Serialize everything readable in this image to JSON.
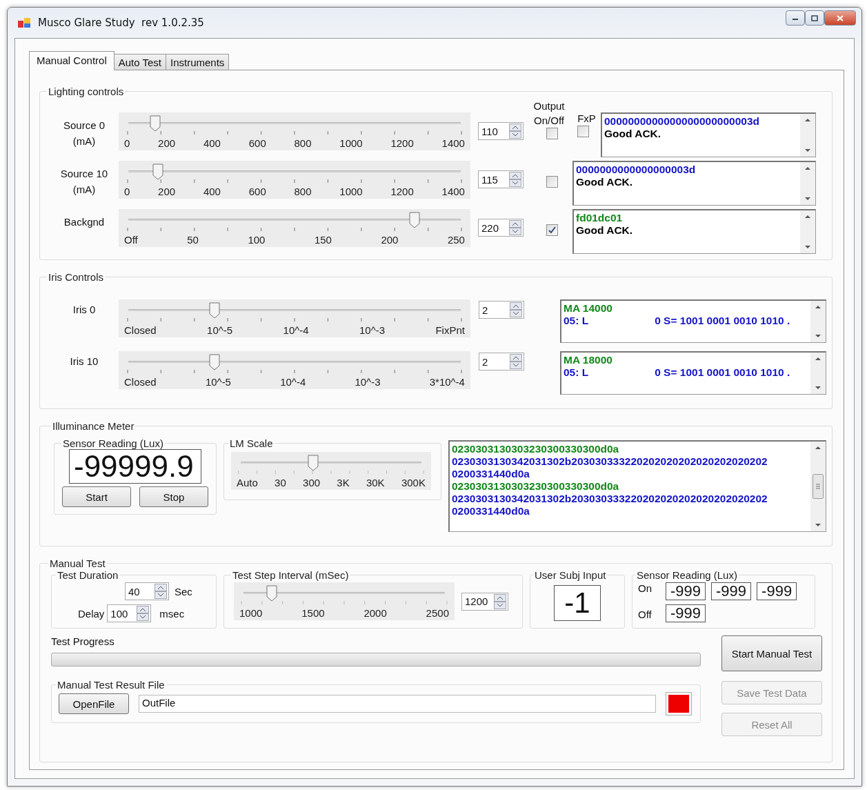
{
  "window": {
    "title": "Musco Glare Study  rev 1.0.2.35"
  },
  "tabs": [
    {
      "label": "Manual Control",
      "selected": true
    },
    {
      "label": "Auto Test",
      "selected": false
    },
    {
      "label": "Instruments",
      "selected": false
    }
  ],
  "lighting_controls": {
    "title": "Lighting controls",
    "output_header": "Output On/Off",
    "rows": [
      {
        "label": "Source 0",
        "unit": "(mA)",
        "level": 0.08,
        "scale": [
          "0",
          "200",
          "400",
          "600",
          "800",
          "1000",
          "1200",
          "1400"
        ],
        "value": "110",
        "output_on": false,
        "fxp": {
          "label": "FxP",
          "checked": false
        },
        "log": [
          {
            "color": "#1414c8",
            "segments": [
              "0000000000000000000000003d"
            ]
          },
          {
            "color": "#000000",
            "segments": [
              "Good ACK."
            ]
          }
        ]
      },
      {
        "label": "Source 10",
        "unit": "(mA)",
        "level": 0.09,
        "scale": [
          "0",
          "200",
          "400",
          "600",
          "800",
          "1000",
          "1200",
          "1400"
        ],
        "value": "115",
        "output_on": false,
        "log": [
          {
            "color": "#1414c8",
            "segments": [
              "0000000000000000003d"
            ]
          },
          {
            "color": "#000000",
            "segments": [
              "Good ACK."
            ]
          }
        ]
      },
      {
        "label": "Backgnd",
        "level": 0.86,
        "scale": [
          "Off",
          "50",
          "100",
          "150",
          "200",
          "250"
        ],
        "value": "220",
        "output_on": true,
        "log": [
          {
            "color": "#12881a",
            "segments": [
              "fd01dc01"
            ]
          },
          {
            "color": "#000000",
            "segments": [
              "Good ACK."
            ]
          }
        ]
      }
    ]
  },
  "iris_controls": {
    "title": "Iris Controls",
    "rows": [
      {
        "label": "Iris 0",
        "level": 0.26,
        "scale": [
          "Closed",
          "10^-5",
          "10^-4",
          "10^-3",
          "FixPnt"
        ],
        "value": "2",
        "log": [
          {
            "color": "#12881a",
            "segments": [
              "MA 14000"
            ]
          },
          {
            "color": "#1414c8",
            "segments": [
              "05: L",
              "0 S= 1001 0001 0010 1010 ."
            ]
          }
        ]
      },
      {
        "label": "Iris 10",
        "level": 0.26,
        "scale": [
          "Closed",
          "10^-5",
          "10^-4",
          "10^-3",
          "3*10^-4"
        ],
        "value": "2",
        "log": [
          {
            "color": "#12881a",
            "segments": [
              "MA 18000"
            ]
          },
          {
            "color": "#1414c8",
            "segments": [
              "05: L",
              "0 S= 1001 0001 0010 1010 ."
            ]
          }
        ]
      }
    ]
  },
  "illuminance_meter": {
    "title": "Illuminance Meter",
    "sensor": {
      "title": "Sensor Reading (Lux)",
      "reading": "-99999.9",
      "buttons": [
        "Start",
        "Stop"
      ]
    },
    "lm_scale": {
      "title": "LM Scale",
      "level": 0.4,
      "scale": [
        "Auto",
        "30",
        "300",
        "3K",
        "30K",
        "300K"
      ]
    },
    "log": [
      {
        "color": "#12881a",
        "segments": [
          "0230303130303230300330300d0a"
        ]
      },
      {
        "color": "#1414c8",
        "segments": [
          "0230303130342031302b203030333220202020202020202020202"
        ]
      },
      {
        "color": "#1414c8",
        "segments": [
          "0200331440d0a"
        ]
      },
      {
        "color": "#12881a",
        "segments": [
          "0230303130303230300330300d0a"
        ]
      },
      {
        "color": "#1414c8",
        "segments": [
          "0230303130342031302b203030333220202020202020202020202"
        ]
      },
      {
        "color": "#1414c8",
        "segments": [
          "0200331440d0a"
        ]
      }
    ]
  },
  "manual_test": {
    "title": "Manual Test",
    "test_duration": {
      "title": "Test Duration",
      "duration": "40",
      "duration_unit": "Sec",
      "delay_label": "Delay",
      "delay": "100",
      "delay_unit": "msec"
    },
    "step_interval": {
      "title": "Test Step Interval (mSec)",
      "level": 0.14,
      "scale": [
        "1000",
        "1500",
        "2000",
        "2500"
      ],
      "value": "1200"
    },
    "user_input": {
      "title": "User Subj Input",
      "value": "-1"
    },
    "sensor_reading": {
      "title": "Sensor Reading (Lux)",
      "on_label": "On",
      "on_values": [
        "-999",
        "-999",
        "-999"
      ],
      "off_label": "Off",
      "off_values": [
        "-999"
      ]
    },
    "progress": {
      "label": "Test Progress",
      "level": 0
    },
    "result_file": {
      "title": "Manual Test Result File",
      "button": "OpenFile",
      "file": "OutFile"
    },
    "buttons": [
      {
        "label": "Start Manual Test",
        "disabled": false
      },
      {
        "label": "Save Test Data",
        "disabled": true
      },
      {
        "label": "Reset All",
        "disabled": true
      }
    ]
  }
}
